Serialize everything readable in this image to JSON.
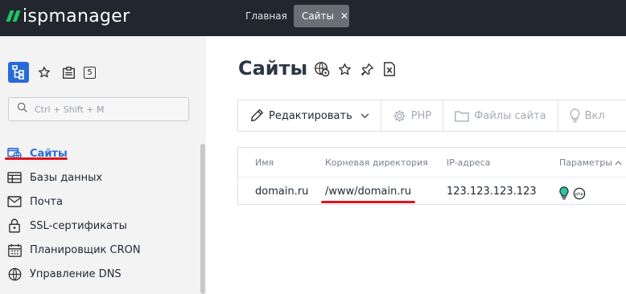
{
  "app": {
    "logo_text": "ispmanager",
    "brand_color": "#21c463",
    "topbar_color": "#22262e",
    "accent_color": "#2a6ad8"
  },
  "tabs": [
    {
      "label": "Главная",
      "active": false
    },
    {
      "label": "Сайты",
      "active": true,
      "closable": true
    }
  ],
  "sidebar": {
    "top_icons": [
      "tree-icon",
      "star-icon",
      "clipboard-icon",
      "badge-5"
    ],
    "badge_value": "5",
    "search": {
      "placeholder": "Ctrl + Shift + M",
      "value": ""
    },
    "items": [
      {
        "label": "Сайты",
        "icon": "sites-icon",
        "active": true
      },
      {
        "label": "Базы данных",
        "icon": "database-icon",
        "active": false
      },
      {
        "label": "Почта",
        "icon": "mail-icon",
        "active": false
      },
      {
        "label": "SSL-сертификаты",
        "icon": "lock-icon",
        "active": false
      },
      {
        "label": "Планировщик CRON",
        "icon": "calendar-icon",
        "active": false
      },
      {
        "label": "Управление DNS",
        "icon": "globe-icon",
        "active": false
      }
    ]
  },
  "main": {
    "title": "Сайты",
    "title_icons": [
      "globe-settings-icon",
      "star-icon",
      "pin-icon",
      "excel-icon"
    ],
    "toolbar": {
      "edit": "Редактировать",
      "php": "PHP",
      "files": "Файлы сайта",
      "enable": "Вкл"
    },
    "table": {
      "columns": [
        "Имя",
        "Корневая директория",
        "IP-адреса",
        "Параметры"
      ],
      "rows": [
        {
          "name": "domain.ru",
          "root": "/www/domain.ru",
          "ip": "123.123.123.123",
          "params": [
            "bulb-icon",
            "php-icon"
          ]
        }
      ]
    }
  }
}
